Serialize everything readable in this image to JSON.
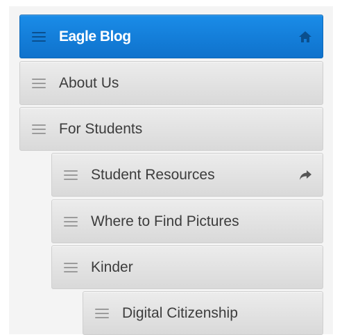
{
  "menu": {
    "items": [
      {
        "label": "Eagle Blog",
        "level": 0,
        "active": true,
        "end_icon": "home-icon"
      },
      {
        "label": "About Us",
        "level": 0
      },
      {
        "label": "For Students",
        "level": 0
      },
      {
        "label": "Student Resources",
        "level": 1,
        "end_icon": "share-arrow-icon"
      },
      {
        "label": "Where to Find Pictures",
        "level": 1
      },
      {
        "label": "Kinder",
        "level": 1
      },
      {
        "label": "Digital Citizenship",
        "level": 2
      }
    ]
  },
  "colors": {
    "header_blue": "#1280dd",
    "item_gray": "#e3e3e3",
    "text_dark": "#3c3c3c"
  }
}
